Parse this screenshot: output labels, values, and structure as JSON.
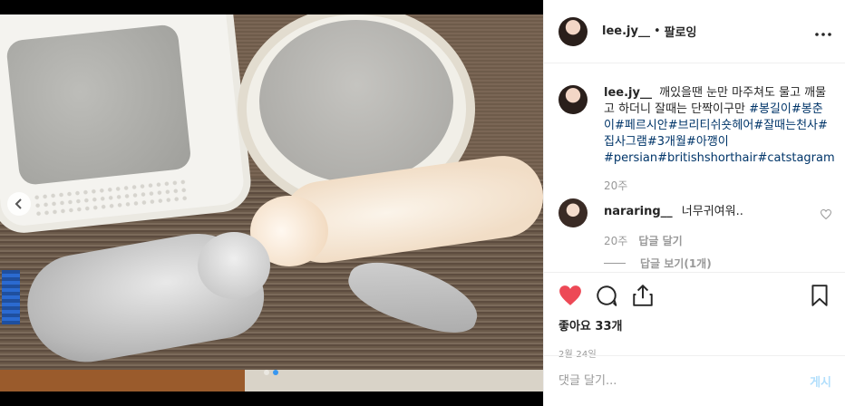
{
  "post": {
    "username": "lee.jy__",
    "separator": "•",
    "follow_label": "팔로잉",
    "more_icon": "more-horizontal-icon"
  },
  "caption": {
    "username": "lee.jy__",
    "text": "깨있을땐 눈만 마주쳐도 물고 깨물고 하더니 잘때는 단짝이구만",
    "hashtags": "#봉길이#봉춘이#페르시안#브리티쉬숏헤어#잘때는천사#집사그램#3개월#아깽이#persian#britishshorthair#catstagram",
    "time": "20주"
  },
  "reply": {
    "username": "nararing__",
    "text": "너무귀여워..",
    "time": "20주",
    "reply_label": "답글 달기",
    "view_replies": "답글 보기(1개)"
  },
  "actions": {
    "likes": "좋아요 33개",
    "date": "2월 24일",
    "accent_like": "#ed4956"
  },
  "comment": {
    "placeholder": "댓글 달기...",
    "post_label": "게시"
  },
  "media": {
    "prev_icon": "chevron-left-icon",
    "dots": 2,
    "active_dot": 1
  }
}
